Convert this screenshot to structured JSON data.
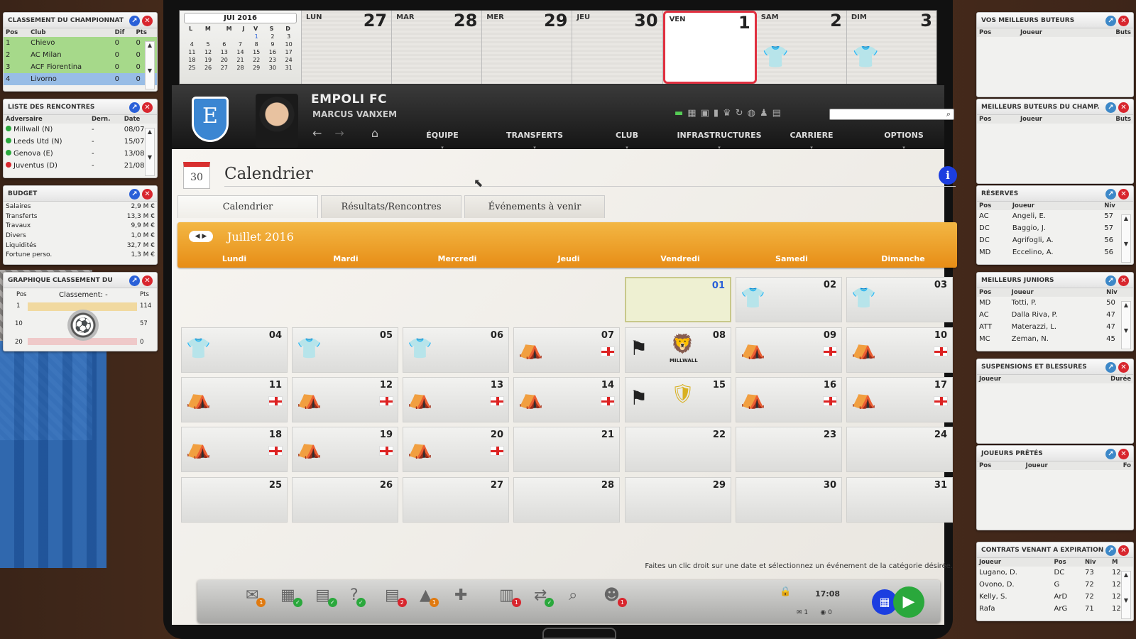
{
  "widgets": {
    "standings": {
      "title": "CLASSEMENT DU CHAMPIONNAT",
      "headers": [
        "Pos",
        "Club",
        "Dif",
        "Pts"
      ],
      "rows": [
        {
          "pos": "1",
          "club": "Chievo",
          "dif": "0",
          "pts": "0"
        },
        {
          "pos": "2",
          "club": "AC Milan",
          "dif": "0",
          "pts": "0"
        },
        {
          "pos": "3",
          "club": "ACF Fiorentina",
          "dif": "0",
          "pts": "0"
        },
        {
          "pos": "4",
          "club": "Livorno",
          "dif": "0",
          "pts": "0"
        }
      ]
    },
    "fixtures": {
      "title": "LISTE DES RENCONTRES",
      "headers": [
        "Adversaire",
        "Dern.",
        "Date"
      ],
      "rows": [
        {
          "opp": "Millwall (N)",
          "last": "-",
          "date": "08/07",
          "color": "#2aa83c"
        },
        {
          "opp": "Leeds Utd (N)",
          "last": "-",
          "date": "15/07",
          "color": "#2aa83c"
        },
        {
          "opp": "Genova (E)",
          "last": "-",
          "date": "13/08",
          "color": "#2aa83c"
        },
        {
          "opp": "Juventus (D)",
          "last": "-",
          "date": "21/08",
          "color": "#d8262e"
        }
      ]
    },
    "budget": {
      "title": "BUDGET",
      "rows": [
        {
          "k": "Salaires",
          "v": "2,9 M €"
        },
        {
          "k": "Transferts",
          "v": "13,3 M €"
        },
        {
          "k": "Travaux",
          "v": "9,9 M €"
        },
        {
          "k": "Divers",
          "v": "1,0 M €"
        },
        {
          "k": "Liquidités",
          "v": "32,7 M €"
        },
        {
          "k": "Fortune perso.",
          "v": "1,3 M €"
        }
      ]
    },
    "graph": {
      "title": "GRAPHIQUE CLASSEMENT DU",
      "pos_label": "Pos",
      "class_label": "Classement: -",
      "pts_label": "Pts",
      "rows": [
        {
          "p": "1",
          "v": "114"
        },
        {
          "p": "10",
          "v": "57"
        },
        {
          "p": "20",
          "v": "0"
        }
      ]
    },
    "scorers": {
      "title": "VOS MEILLEURS BUTEURS",
      "headers": [
        "Pos",
        "Joueur",
        "Buts"
      ]
    },
    "champ_scorers": {
      "title": "MEILLEURS BUTEURS DU CHAMP.",
      "headers": [
        "Pos",
        "Joueur",
        "Buts"
      ]
    },
    "reserves": {
      "title": "RÉSERVES",
      "headers": [
        "Pos",
        "Joueur",
        "Niv"
      ],
      "rows": [
        {
          "pos": "AC",
          "name": "Angeli, E.",
          "niv": "57"
        },
        {
          "pos": "DC",
          "name": "Baggio, J.",
          "niv": "57"
        },
        {
          "pos": "DC",
          "name": "Agrifogli, A.",
          "niv": "56"
        },
        {
          "pos": "MD",
          "name": "Eccelino, A.",
          "niv": "56"
        }
      ]
    },
    "juniors": {
      "title": "MEILLEURS JUNIORS",
      "headers": [
        "Pos",
        "Joueur",
        "Niv"
      ],
      "rows": [
        {
          "pos": "MD",
          "name": "Totti, P.",
          "niv": "50"
        },
        {
          "pos": "AC",
          "name": "Dalla Riva, P.",
          "niv": "47"
        },
        {
          "pos": "ATT",
          "name": "Materazzi, L.",
          "niv": "47"
        },
        {
          "pos": "MC",
          "name": "Zeman, N.",
          "niv": "45"
        }
      ]
    },
    "injuries": {
      "title": "SUSPENSIONS ET BLESSURES",
      "headers": [
        "Joueur",
        "Durée"
      ]
    },
    "loans": {
      "title": "JOUEURS PRÊTÉS",
      "headers": [
        "Pos",
        "Joueur",
        "Fo"
      ]
    },
    "contracts": {
      "title": "CONTRATS VENANT A EXPIRATION",
      "headers": [
        "Joueur",
        "Pos",
        "Niv",
        "M"
      ],
      "rows": [
        {
          "name": "Lugano, D.",
          "pos": "DC",
          "niv": "73",
          "m": "12"
        },
        {
          "name": "Ovono, D.",
          "pos": "G",
          "niv": "72",
          "m": "12"
        },
        {
          "name": "Kelly, S.",
          "pos": "ArD",
          "niv": "72",
          "m": "12"
        },
        {
          "name": "Rafa",
          "pos": "ArG",
          "niv": "71",
          "m": "12"
        }
      ]
    }
  },
  "strip": {
    "mini_title": "JUI 2016",
    "mini_days": [
      "L",
      "M",
      "M",
      "J",
      "V",
      "S",
      "D"
    ],
    "mini_weeks": [
      [
        "",
        "",
        "",
        "",
        "1",
        "2",
        "3"
      ],
      [
        "4",
        "5",
        "6",
        "7",
        "8",
        "9",
        "10"
      ],
      [
        "11",
        "12",
        "13",
        "14",
        "15",
        "16",
        "17"
      ],
      [
        "18",
        "19",
        "20",
        "21",
        "22",
        "23",
        "24"
      ],
      [
        "25",
        "26",
        "27",
        "28",
        "29",
        "30",
        "31"
      ]
    ],
    "days": [
      {
        "n": "LUN",
        "d": "27"
      },
      {
        "n": "MAR",
        "d": "28"
      },
      {
        "n": "MER",
        "d": "29"
      },
      {
        "n": "JEU",
        "d": "30"
      },
      {
        "n": "VEN",
        "d": "1"
      },
      {
        "n": "SAM",
        "d": "2"
      },
      {
        "n": "DIM",
        "d": "3"
      }
    ]
  },
  "header": {
    "crest_letter": "E",
    "club": "EMPOLI FC",
    "manager": "MARCUS VANXEM",
    "nav": [
      "ÉQUIPE",
      "TRANSFERTS",
      "CLUB",
      "INFRASTRUCTURES",
      "CARRIERE",
      "OPTIONS"
    ]
  },
  "page": {
    "title": "Calendrier",
    "calicon_num": "30",
    "info": "i",
    "tabs": [
      "Calendrier",
      "Résultats/Rencontres",
      "Événements à venir"
    ],
    "month": "Juillet 2016",
    "weekdays": [
      "Lundi",
      "Mardi",
      "Mercredi",
      "Jeudi",
      "Vendredi",
      "Samedi",
      "Dimanche"
    ],
    "hint": "Faites un clic droit sur une date et sélectionnez un événement de la catégorie désirée.",
    "opp_millwall": "MILLWALL"
  },
  "calendar": [
    {
      "d": "01",
      "t": "today"
    },
    {
      "d": "02",
      "t": "train"
    },
    {
      "d": "03",
      "t": "train"
    },
    {
      "d": "04",
      "t": "train"
    },
    {
      "d": "05",
      "t": "train"
    },
    {
      "d": "06",
      "t": "train"
    },
    {
      "d": "07",
      "t": "camp"
    },
    {
      "d": "08",
      "t": "match-millwall"
    },
    {
      "d": "09",
      "t": "camp"
    },
    {
      "d": "10",
      "t": "camp"
    },
    {
      "d": "11",
      "t": "camp"
    },
    {
      "d": "12",
      "t": "camp"
    },
    {
      "d": "13",
      "t": "camp"
    },
    {
      "d": "14",
      "t": "camp"
    },
    {
      "d": "15",
      "t": "match-leeds"
    },
    {
      "d": "16",
      "t": "camp"
    },
    {
      "d": "17",
      "t": "camp"
    },
    {
      "d": "18",
      "t": "camp"
    },
    {
      "d": "19",
      "t": "camp"
    },
    {
      "d": "20",
      "t": "camp"
    },
    {
      "d": "21",
      "t": ""
    },
    {
      "d": "22",
      "t": ""
    },
    {
      "d": "23",
      "t": ""
    },
    {
      "d": "24",
      "t": ""
    },
    {
      "d": "25",
      "t": ""
    },
    {
      "d": "26",
      "t": ""
    },
    {
      "d": "27",
      "t": ""
    },
    {
      "d": "28",
      "t": ""
    },
    {
      "d": "29",
      "t": ""
    },
    {
      "d": "30",
      "t": ""
    },
    {
      "d": "31",
      "t": ""
    }
  ],
  "bottombar": {
    "time": "17:08",
    "mail_count": "1",
    "chat_count": "0",
    "icons": [
      {
        "name": "mail-icon",
        "g": "✉",
        "badge": "1",
        "c": "#e07a10"
      },
      {
        "name": "calendar-icon",
        "g": "▦",
        "badge": "✓",
        "c": "#2aa83c"
      },
      {
        "name": "tactics-icon",
        "g": "▤",
        "badge": "✓",
        "c": "#2aa83c"
      },
      {
        "name": "scouting-icon",
        "g": "?",
        "badge": "✓",
        "c": "#2aa83c"
      },
      {
        "name": "training-icon",
        "g": "▤",
        "badge": "2",
        "c": "#d8262e"
      },
      {
        "name": "cone-icon",
        "g": "▲",
        "badge": "1",
        "c": "#e07a10"
      },
      {
        "name": "medical-icon",
        "g": "✚",
        "badge": "",
        "c": ""
      },
      {
        "name": "contracts-icon",
        "g": "▥",
        "badge": "1",
        "c": "#d8262e"
      },
      {
        "name": "transfer-icon",
        "g": "⇄",
        "badge": "✓",
        "c": "#2aa83c"
      },
      {
        "name": "search-players-icon",
        "g": "⌕",
        "badge": "",
        "c": ""
      },
      {
        "name": "staff-icon",
        "g": "☻",
        "badge": "1",
        "c": "#d8262e"
      }
    ]
  }
}
